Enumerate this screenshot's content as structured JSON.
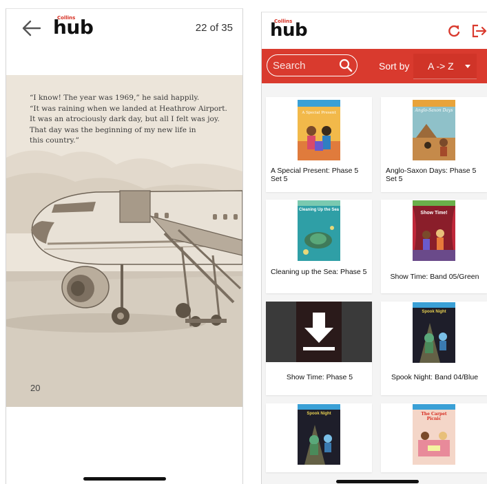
{
  "reader": {
    "brand_small": "Collins",
    "logo_text": "hub",
    "page_counter": "22 of 35",
    "story_lines": [
      "“I know! The year was 1969,” he said happily.",
      "“It was raining when we landed at Heathrow Airport.",
      "It was an atrociously dark day, but all I felt was joy.",
      "That day was the beginning of my new life in",
      "this country.”"
    ],
    "page_number": "20"
  },
  "library": {
    "brand_small": "Collins",
    "logo_text": "hub",
    "search": {
      "placeholder": "Search"
    },
    "sort": {
      "label": "Sort by",
      "value": "A -> Z"
    },
    "books": [
      {
        "title": "A Special Present: Phase 5 Set 5",
        "cover_text": "A Special Present",
        "downloading": false
      },
      {
        "title": "Anglo-Saxon Days: Phase 5 Set 5",
        "cover_text": "Anglo-Saxon Days",
        "downloading": false
      },
      {
        "title": "Cleaning up the Sea: Phase 5",
        "cover_text": "Cleaning Up the Sea",
        "downloading": false
      },
      {
        "title": "Show Time: Band 05/Green",
        "cover_text": "Show Time!",
        "downloading": false
      },
      {
        "title": "Show Time: Phase 5",
        "cover_text": "",
        "downloading": true
      },
      {
        "title": "Spook Night: Band 04/Blue",
        "cover_text": "Spook Night",
        "downloading": false
      },
      {
        "title": "",
        "cover_text": "Spook Night",
        "downloading": false
      },
      {
        "title": "",
        "cover_text": "The Carpet Picnic",
        "downloading": false
      }
    ]
  },
  "colors": {
    "accent": "#d93a2e",
    "brand_red": "#d62d20",
    "page_bg": "#ece5da",
    "sepia": "#8a7c6c"
  },
  "icons": [
    "back-arrow-icon",
    "search-icon",
    "refresh-icon",
    "logout-icon",
    "download-icon",
    "chevron-down-icon"
  ]
}
